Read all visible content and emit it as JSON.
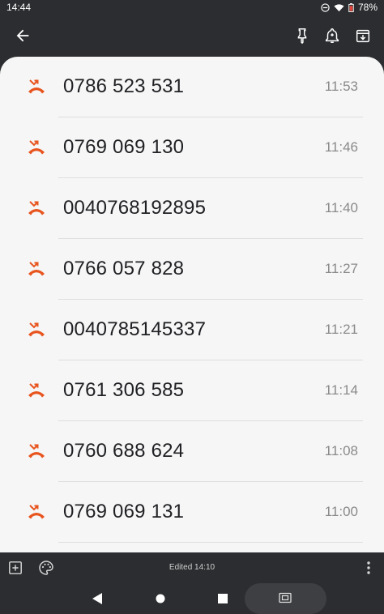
{
  "status_bar": {
    "time": "14:44",
    "battery": "78%",
    "icons": [
      "dnd-icon",
      "wifi-icon",
      "battery-icon"
    ]
  },
  "toolbar": {
    "icons": [
      "back-arrow-icon",
      "pin-icon",
      "reminder-bell-icon",
      "archive-icon"
    ]
  },
  "calls": [
    {
      "number": "0786 523 531",
      "time": "11:53"
    },
    {
      "number": "0769 069 130",
      "time": "11:46"
    },
    {
      "number": "0040768192895",
      "time": "11:40"
    },
    {
      "number": "0766 057 828",
      "time": "11:27"
    },
    {
      "number": "0040785145337",
      "time": "11:21"
    },
    {
      "number": "0761 306 585",
      "time": "11:14"
    },
    {
      "number": "0760 688 624",
      "time": "11:08"
    },
    {
      "number": "0769 069 131",
      "time": "11:00"
    }
  ],
  "bottom_bar": {
    "edited": "Edited 14:10"
  },
  "colors": {
    "missed_call": "#e8541e",
    "chrome_bg": "#2b2d30",
    "note_bg": "#f6f6f6"
  }
}
